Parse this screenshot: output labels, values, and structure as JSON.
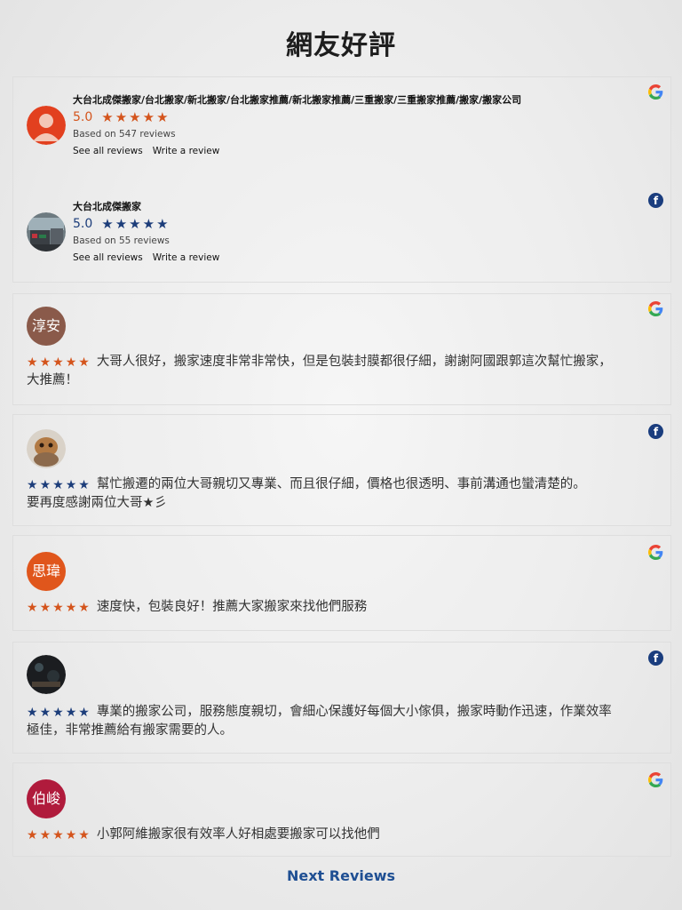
{
  "page_title": "網友好評",
  "colors": {
    "google_star": "#d4541c",
    "facebook_star": "#1c3d7a",
    "link": "#1f4f93"
  },
  "summaries": [
    {
      "source": "google-icon",
      "name": "大台北成傑搬家/台北搬家/新北搬家/台北搬家推薦/新北搬家推薦/三重搬家/三重搬家推薦/搬家/搬家公司",
      "rating": "5.0",
      "stars": 5,
      "based_on": "Based on 547 reviews",
      "see_all": "See all reviews",
      "write": "Write a review"
    },
    {
      "source": "facebook-icon",
      "name": "大台北成傑搬家",
      "rating": "5.0",
      "stars": 5,
      "based_on": "Based on 55 reviews",
      "see_all": "See all reviews",
      "write": "Write a review"
    }
  ],
  "reviews": [
    {
      "source": "google-icon",
      "avatar_text": "淳安",
      "stars": 5,
      "lines": [
        "大哥人很好，搬家速度非常非常快，但是包裝封膜都很仔細，謝謝阿國跟郭這次幫忙搬家，",
        "大推薦！"
      ]
    },
    {
      "source": "facebook-icon",
      "avatar_text": "",
      "stars": 5,
      "lines": [
        "幫忙搬遷的兩位大哥親切又專業、而且很仔細，價格也很透明、事前溝通也蠻清楚的。",
        "要再度感謝兩位大哥★彡"
      ]
    },
    {
      "source": "google-icon",
      "avatar_text": "思瑋",
      "stars": 5,
      "lines": [
        "速度快，包裝良好！推薦大家搬家來找他們服務"
      ]
    },
    {
      "source": "facebook-icon",
      "avatar_text": "",
      "stars": 5,
      "lines": [
        "專業的搬家公司，服務態度親切，會細心保護好每個大小傢俱，搬家時動作迅速，作業效率",
        "極佳，非常推薦給有搬家需要的人。"
      ]
    },
    {
      "source": "google-icon",
      "avatar_text": "伯峻",
      "stars": 5,
      "lines": [
        "小郭阿維搬家很有效率人好相處要搬家可以找他們"
      ]
    }
  ],
  "next_reviews": "Next Reviews",
  "facebook_glyph": "f"
}
